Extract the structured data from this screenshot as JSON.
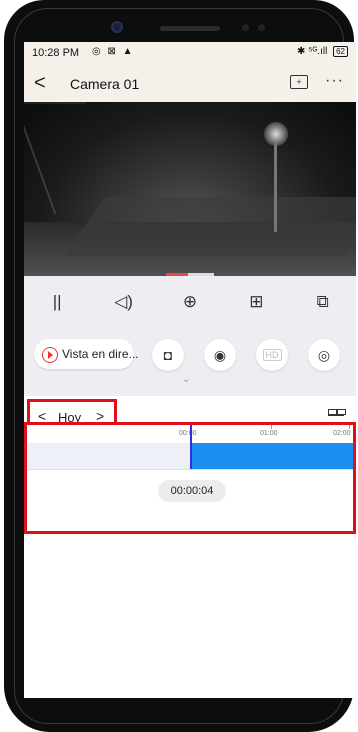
{
  "status_bar": {
    "time": "10:28 PM",
    "icons": "◎ ⊠ ▲",
    "right": "✱ ⁵ᴳ.ıll",
    "battery": "62"
  },
  "header": {
    "back_glyph": "<",
    "title": "Camera 01",
    "record_glyph": "+",
    "more_glyph": "···"
  },
  "controls": [
    {
      "name": "pause-icon",
      "glyph": "||"
    },
    {
      "name": "volume-icon",
      "glyph": "◁)"
    },
    {
      "name": "zoom-in-icon",
      "glyph": "⊕"
    },
    {
      "name": "grid-icon",
      "glyph": "⊞"
    },
    {
      "name": "screen-icon",
      "glyph": "⧉"
    }
  ],
  "actions": {
    "live_label": "Vista en dire...",
    "snapshot_glyph": "◘",
    "record_glyph": "◉",
    "hd_label": "HD",
    "ptz_glyph": "◎",
    "expand_glyph": "⌄"
  },
  "date": {
    "prev_glyph": "<",
    "label": "Hoy",
    "next_glyph": ">"
  },
  "timeline": {
    "ticks": [
      "00:00",
      "01:00",
      "02:00"
    ],
    "current_time": "00:00:04"
  },
  "colors": {
    "accent": "#1a8ff0",
    "highlight": "#e0101a",
    "live_red": "#e33333"
  }
}
